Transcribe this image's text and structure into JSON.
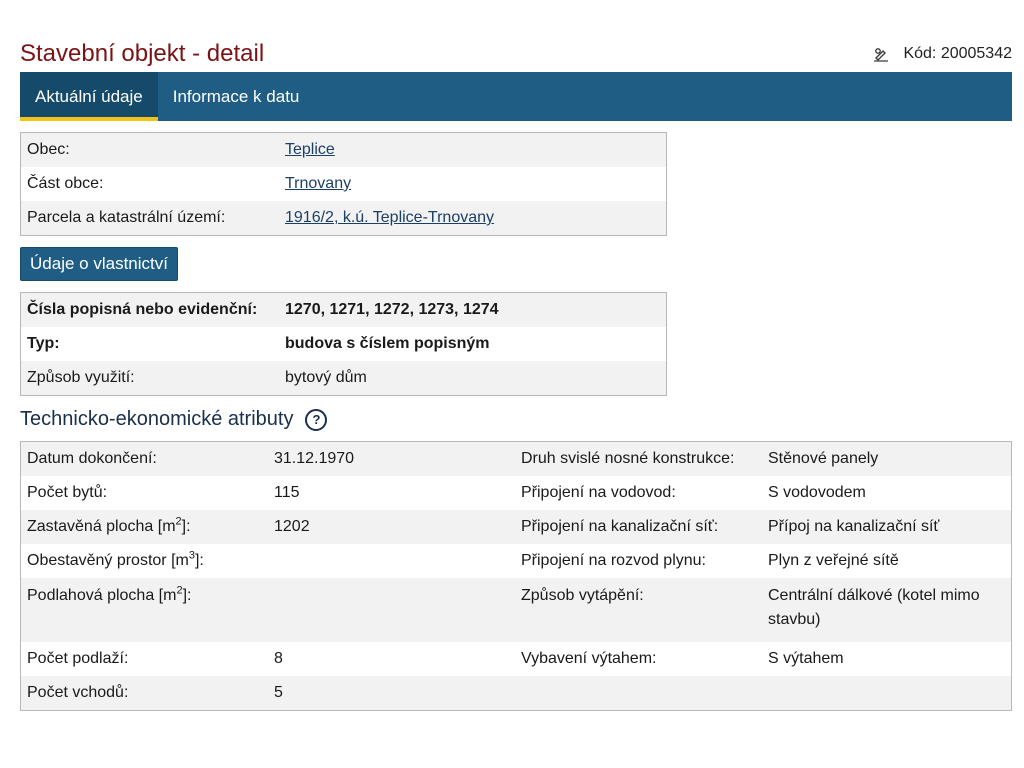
{
  "header": {
    "title": "Stavební objekt - detail",
    "code": "Kód: 20005342"
  },
  "tabs": [
    {
      "label": "Aktuální údaje"
    },
    {
      "label": "Informace k datu"
    }
  ],
  "location": {
    "rows": [
      {
        "label": "Obec:",
        "value": "Teplice"
      },
      {
        "label": "Část obce:",
        "value": "Trnovany"
      },
      {
        "label": "Parcela a katastrální území:",
        "value": "1916/2, k.ú. Teplice-Trnovany"
      }
    ]
  },
  "ownership_button": "Údaje o vlastnictví",
  "building": {
    "rows": [
      {
        "label": "Čísla popisná nebo evidenční:",
        "value": "1270, 1271, 1272, 1273, 1274"
      },
      {
        "label": "Typ:",
        "value": "budova s číslem popisným"
      },
      {
        "label": "Způsob využití:",
        "value": "bytový dům"
      }
    ]
  },
  "tech": {
    "title": "Technicko-ekonomické atributy",
    "help": "?",
    "rows": [
      {
        "l1": "Datum dokončení:",
        "v1": "31.12.1970",
        "l2": "Druh svislé nosné konstrukce:",
        "v2": "Stěnové panely"
      },
      {
        "l1": "Počet bytů:",
        "v1": "115",
        "l2": "Připojení na vodovod:",
        "v2": "S vodovodem"
      },
      {
        "l1": "Zastavěná plocha [m",
        "sup1": "2",
        "l1end": "]:",
        "v1": "1202",
        "l2": "Připojení na kanalizační síť:",
        "v2": "Přípoj na kanalizační síť"
      },
      {
        "l1": "Obestavěný prostor [m",
        "sup1": "3",
        "l1end": "]:",
        "v1": "",
        "l2": "Připojení na rozvod plynu:",
        "v2": "Plyn z veřejné sítě"
      },
      {
        "l1": "Podlahová plocha [m",
        "sup1": "2",
        "l1end": "]:",
        "v1": "",
        "l2": "Způsob vytápění:",
        "v2": "Centrální dálkové (kotel mimo stavbu)"
      },
      {
        "l1": "Počet podlaží:",
        "v1": "8",
        "l2": "Vybavení výtahem:",
        "v2": "S výtahem"
      },
      {
        "l1": "Počet vchodů:",
        "v1": "5",
        "l2": "",
        "v2": ""
      }
    ]
  }
}
